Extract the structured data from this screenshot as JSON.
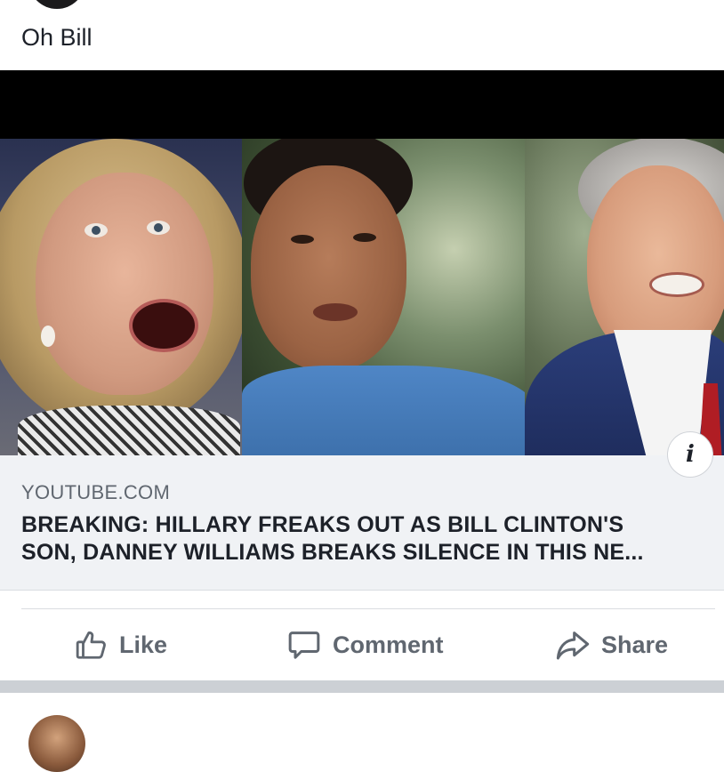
{
  "post": {
    "text": "Oh Bill"
  },
  "link_preview": {
    "domain": "YOUTUBE.COM",
    "headline_line1": "BREAKING: HILLARY FREAKS OUT AS BILL CLINTON'S",
    "headline_line2": "SON, DANNEY WILLIAMS BREAKS SILENCE IN THIS NE...",
    "info_icon": "i"
  },
  "actions": {
    "like_label": "Like",
    "comment_label": "Comment",
    "share_label": "Share"
  },
  "icons": {
    "like": "thumbs-up-icon",
    "comment": "speech-bubble-icon",
    "share": "share-arrow-icon",
    "info": "info-icon"
  },
  "colors": {
    "text_primary": "#1d2129",
    "text_secondary": "#606770",
    "preview_background": "#f0f2f5",
    "separator": "#ccd0d5"
  }
}
